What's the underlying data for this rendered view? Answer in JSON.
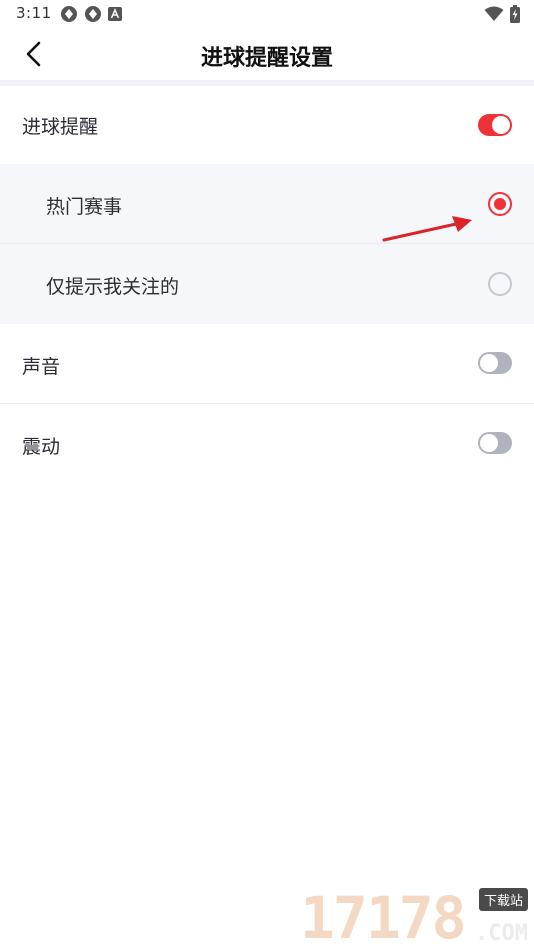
{
  "status_bar": {
    "time": "3:11",
    "left_icons": [
      "sync-icon",
      "sync-icon",
      "a-badge-icon"
    ],
    "right_icons": [
      "wifi-icon",
      "battery-charging-icon"
    ]
  },
  "nav": {
    "back_icon": "chevron-left-icon",
    "title": "进球提醒设置"
  },
  "settings": {
    "goal_alert": {
      "label": "进球提醒",
      "enabled": true
    },
    "options": [
      {
        "label": "热门赛事",
        "selected": true
      },
      {
        "label": "仅提示我关注的",
        "selected": false
      }
    ],
    "sound": {
      "label": "声音",
      "enabled": false
    },
    "vibration": {
      "label": "震动",
      "enabled": false
    }
  },
  "annotation": {
    "icon": "red-arrow-icon",
    "color": "#d9252a"
  },
  "colors": {
    "accent": "#f03237",
    "toggle_off": "#b0b3bd",
    "sub_row_bg": "#f6f7fa"
  },
  "watermark": {
    "digits": "17178",
    "badge": "下载站",
    "domain": ".COM"
  }
}
